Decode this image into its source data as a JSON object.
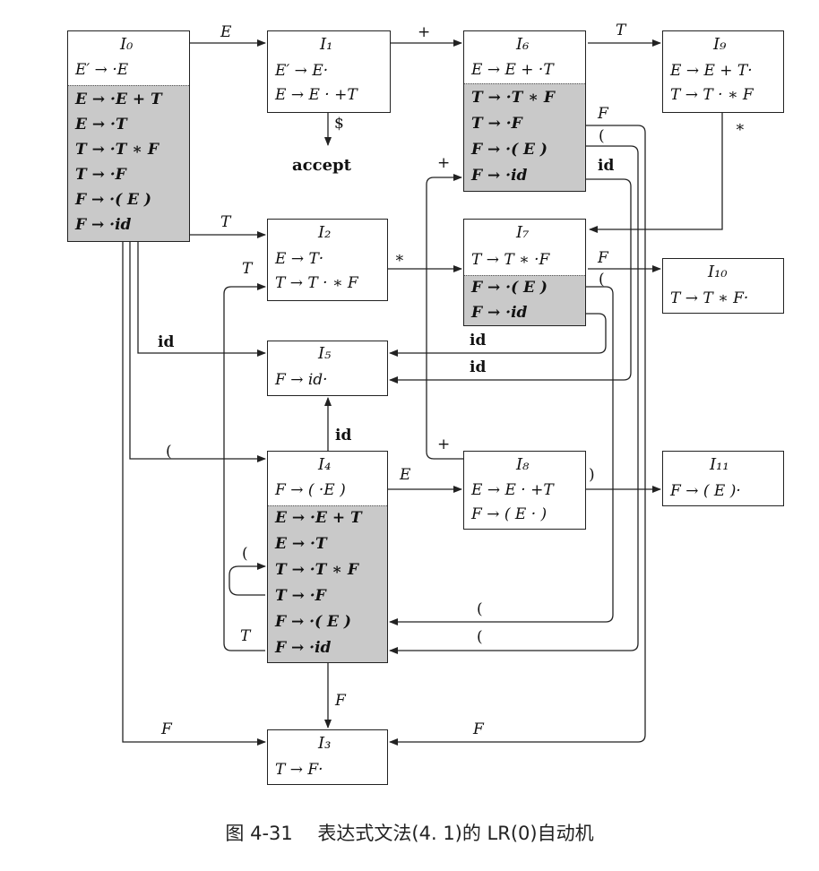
{
  "states": [
    {
      "id": "I0",
      "title": "I₀",
      "kernel": [
        "E′ → ·E"
      ],
      "closure": [
        "E → ·E + T",
        "E → ·T",
        "T → ·T ∗ F",
        "T → ·F",
        "F → ·( E )",
        "F → ·id"
      ]
    },
    {
      "id": "I1",
      "title": "I₁",
      "kernel": [
        "E′ → E·",
        "E → E · +T"
      ],
      "closure": []
    },
    {
      "id": "I2",
      "title": "I₂",
      "kernel": [
        "E → T·",
        "T → T · ∗ F"
      ],
      "closure": []
    },
    {
      "id": "I3",
      "title": "I₃",
      "kernel": [
        "T → F·"
      ],
      "closure": []
    },
    {
      "id": "I4",
      "title": "I₄",
      "kernel": [
        "F → ( ·E )"
      ],
      "closure": [
        "E → ·E + T",
        "E → ·T",
        "T → ·T ∗ F",
        "T → ·F",
        "F → ·( E )",
        "F → ·id"
      ]
    },
    {
      "id": "I5",
      "title": "I₅",
      "kernel": [
        "F → id·"
      ],
      "closure": []
    },
    {
      "id": "I6",
      "title": "I₆",
      "kernel": [
        "E → E + ·T"
      ],
      "closure": [
        "T → ·T ∗ F",
        "T → ·F",
        "F → ·( E )",
        "F → ·id"
      ]
    },
    {
      "id": "I7",
      "title": "I₇",
      "kernel": [
        "T → T ∗ ·F"
      ],
      "closure": [
        "F → ·( E )",
        "F → ·id"
      ]
    },
    {
      "id": "I8",
      "title": "I₈",
      "kernel": [
        "E → E · +T",
        "F → ( E · )"
      ],
      "closure": []
    },
    {
      "id": "I9",
      "title": "I₉",
      "kernel": [
        "E → E + T·",
        "T → T · ∗ F"
      ],
      "closure": []
    },
    {
      "id": "I10",
      "title": "I₁₀",
      "kernel": [
        "T → T ∗ F·"
      ],
      "closure": []
    },
    {
      "id": "I11",
      "title": "I₁₁",
      "kernel": [
        "F → ( E )·"
      ],
      "closure": []
    }
  ],
  "accept_label": "accept",
  "dollar_label": "$",
  "edge_labels": {
    "I0_I1": "E",
    "I1_I6": "+",
    "I6_I9": "T",
    "I9_I7": "∗",
    "I6_I3": "F",
    "I6_I4": "(",
    "I6_I5": "id",
    "I0_I2": "T",
    "I2_I7": "∗",
    "I7_I10": "F",
    "I7_I4": "(",
    "I7_I5": "id",
    "I0_I5": "id",
    "I4_I5": "id",
    "I8_I6": "+",
    "I0_I4": "(",
    "I4_I8": "E",
    "I8_I11": ")",
    "I4_I4": "(",
    "I4_I2": "T",
    "I4_I3": "F",
    "I0_I3": "F",
    "to_I3": "F",
    "to_I4_a": "(",
    "to_I4_b": "("
  },
  "caption": "图 4-31　 表达式文法(4. 1)的 LR(0)自动机"
}
